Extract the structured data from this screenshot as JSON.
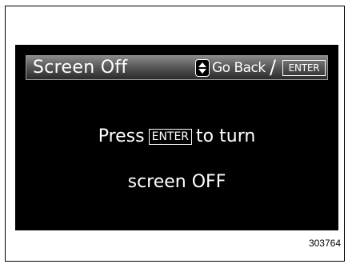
{
  "header": {
    "title": "Screen Off",
    "updown_icon": "up-down-arrow-icon",
    "goback_label": "Go Back",
    "separator": "/",
    "enter_key": "ENTER"
  },
  "message": {
    "line1_before": "Press",
    "key_label": "ENTER",
    "line1_after": "to turn",
    "line2": "screen OFF"
  },
  "figure_number": "303764",
  "colors": {
    "screen_background": "#000000",
    "text": "#ffffff"
  }
}
